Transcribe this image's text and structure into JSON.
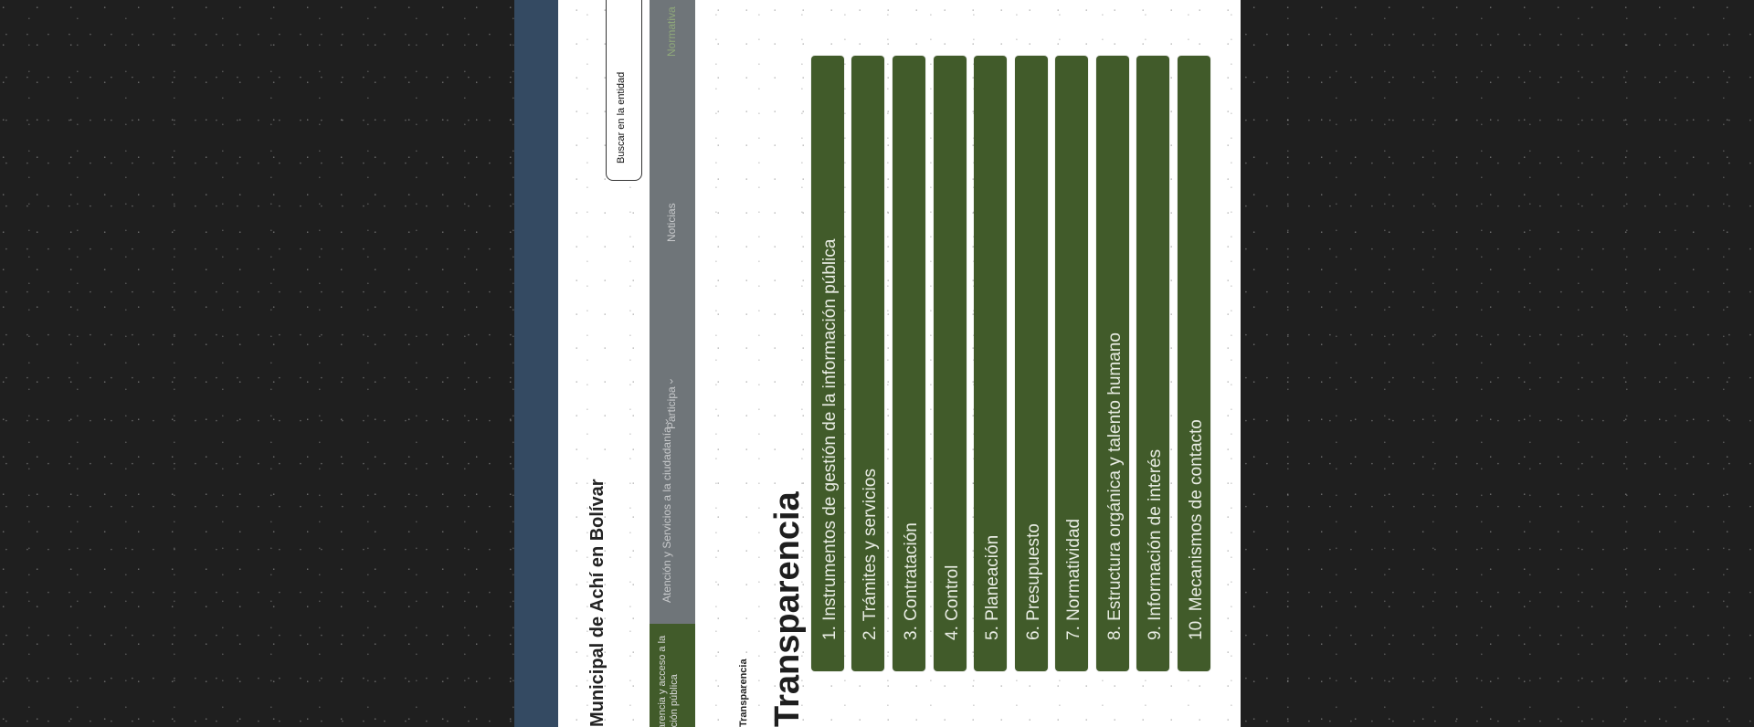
{
  "header": {
    "entity_title": "Municipal de Achí en Bolívar",
    "search_label": "Buscar en la entidad"
  },
  "nav": {
    "active_item": "Transparencia y acceso a la información pública",
    "items": [
      "Atención y Servicios a la ciudadanía",
      "Participa",
      "Noticias",
      "Normativa"
    ]
  },
  "breadcrumb": "Transparencia",
  "page_title": "Transparencia",
  "sections": [
    {
      "num": "1.",
      "label": "Instrumentos de gestión de la información pública"
    },
    {
      "num": "2.",
      "label": "Trámites y servicios"
    },
    {
      "num": "3.",
      "label": "Contratación"
    },
    {
      "num": "4.",
      "label": "Control"
    },
    {
      "num": "5.",
      "label": "Planeación"
    },
    {
      "num": "6.",
      "label": "Presupuesto"
    },
    {
      "num": "7.",
      "label": "Normatividad"
    },
    {
      "num": "8.",
      "label": "Estructura orgánica y talento humano"
    },
    {
      "num": "9.",
      "label": "Información de interés"
    },
    {
      "num": "10.",
      "label": "Mecanismos de contacto"
    }
  ],
  "colors": {
    "gov_bar": "#344a62",
    "nav_bar": "#6f7579",
    "accent_green": "#415b2a"
  }
}
